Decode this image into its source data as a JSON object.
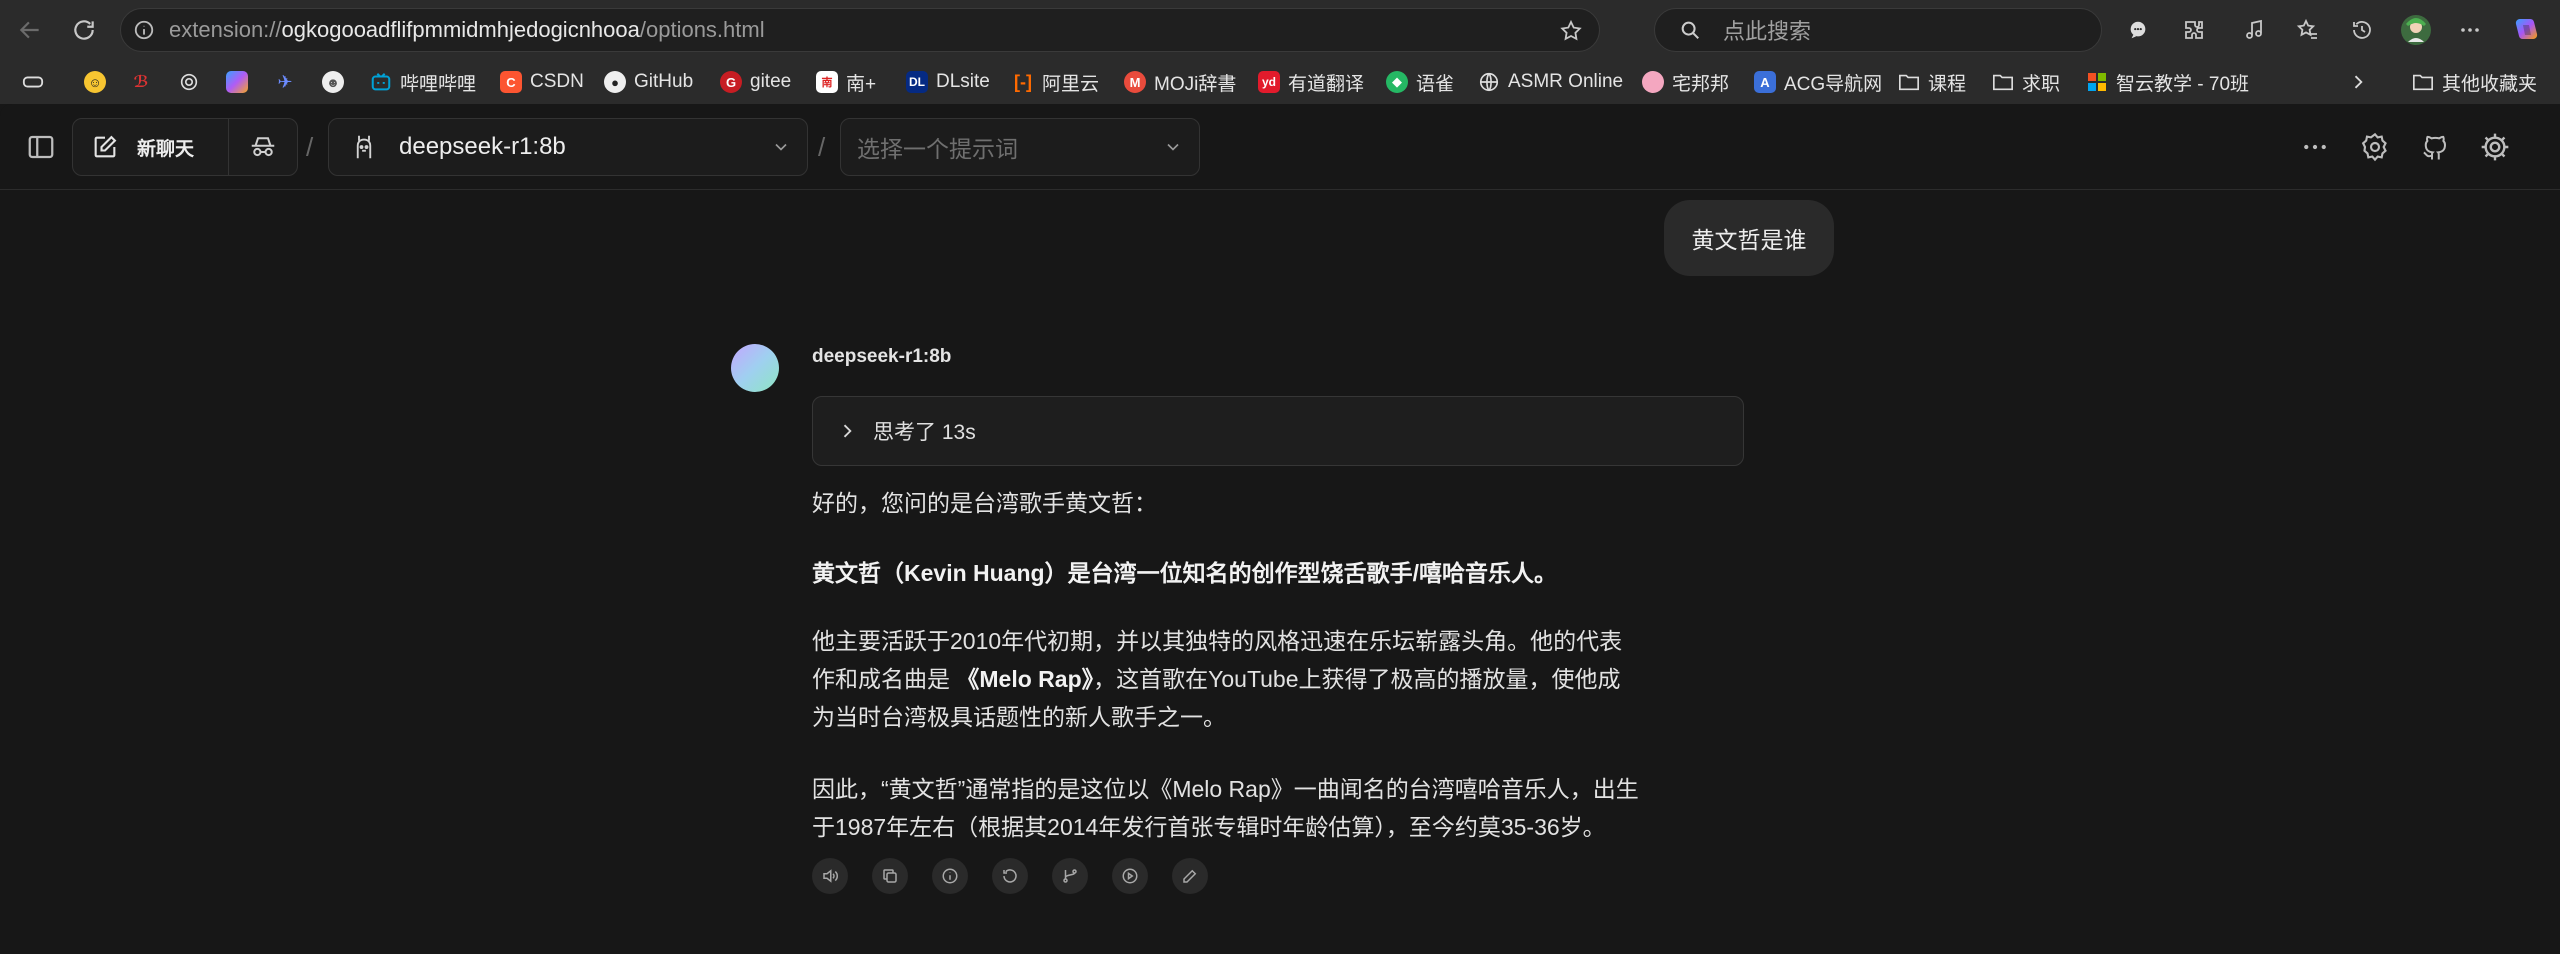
{
  "browser": {
    "url_prefix": "extension://",
    "url_host": "ogkogooadflifpmmidmhjedogicnhooa",
    "url_path": "/options.html",
    "search_placeholder": "点此搜索"
  },
  "bookmarks": [
    {
      "label": "",
      "icon": "tab-group-icon"
    },
    {
      "label": "",
      "icon": "emoji-face-icon"
    },
    {
      "label": "",
      "icon": "acg-logo-icon"
    },
    {
      "label": "",
      "icon": "openai-icon"
    },
    {
      "label": "",
      "icon": "copilot-icon"
    },
    {
      "label": "",
      "icon": "bird-icon"
    },
    {
      "label": "",
      "icon": "avatar-icon"
    },
    {
      "label": "哔哩哔哩",
      "icon": "bilibili-icon"
    },
    {
      "label": "CSDN",
      "icon": "csdn-icon"
    },
    {
      "label": "GitHub",
      "icon": "github-icon"
    },
    {
      "label": "gitee",
      "icon": "gitee-icon"
    },
    {
      "label": "南+",
      "icon": "south-plus-icon"
    },
    {
      "label": "DLsite",
      "icon": "dlsite-icon"
    },
    {
      "label": "阿里云",
      "icon": "aliyun-icon"
    },
    {
      "label": "MOJi辞書",
      "icon": "moji-icon"
    },
    {
      "label": "有道翻译",
      "icon": "youdao-icon"
    },
    {
      "label": "语雀",
      "icon": "yuque-icon"
    },
    {
      "label": "ASMR Online",
      "icon": "globe-icon"
    },
    {
      "label": "宅邦邦",
      "icon": "pink-circle-icon"
    },
    {
      "label": "ACG导航网",
      "icon": "acg-nav-icon"
    },
    {
      "label": "课程",
      "icon": "folder-icon"
    },
    {
      "label": "求职",
      "icon": "folder-icon"
    },
    {
      "label": "智云教学 - 70班",
      "icon": "microsoft-icon"
    }
  ],
  "bookmarks_more_label": "其他收藏夹",
  "header": {
    "new_chat_label": "新聊天",
    "model_name": "deepseek-r1:8b",
    "prompt_placeholder": "选择一个提示词",
    "separator": "/"
  },
  "chat": {
    "user_message": "黄文哲是谁",
    "bot_name": "deepseek-r1:8b",
    "thinking_label": "思考了 13s",
    "p1": "好的，您问的是台湾歌手黄文哲：",
    "p2": "黄文哲（Kevin Huang）是台湾一位知名的创作型饶舌歌手/嘻哈音乐人。",
    "p3_line1": "他主要活跃于2010年代初期，并以其独特的风格迅速在乐坛崭露头角。他的代表",
    "p3_line2_a": "作和成名曲是 ",
    "p3_line2_b": "《Melo Rap》",
    "p3_line2_c": "，这首歌在YouTube上获得了极高的播放量，使他成",
    "p3_line3": "为当时台湾极具话题性的新人歌手之一。",
    "p4_line1": "因此，“黄文哲”通常指的是这位以《Melo Rap》一曲闻名的台湾嘻哈音乐人，出生",
    "p4_line2": "于1987年左右（根据其2014年发行首张专辑时年龄估算），至今约莫35-36岁。"
  },
  "message_actions": [
    "speaker-icon",
    "copy-icon",
    "info-icon",
    "regenerate-icon",
    "branch-icon",
    "play-icon",
    "edit-icon"
  ]
}
